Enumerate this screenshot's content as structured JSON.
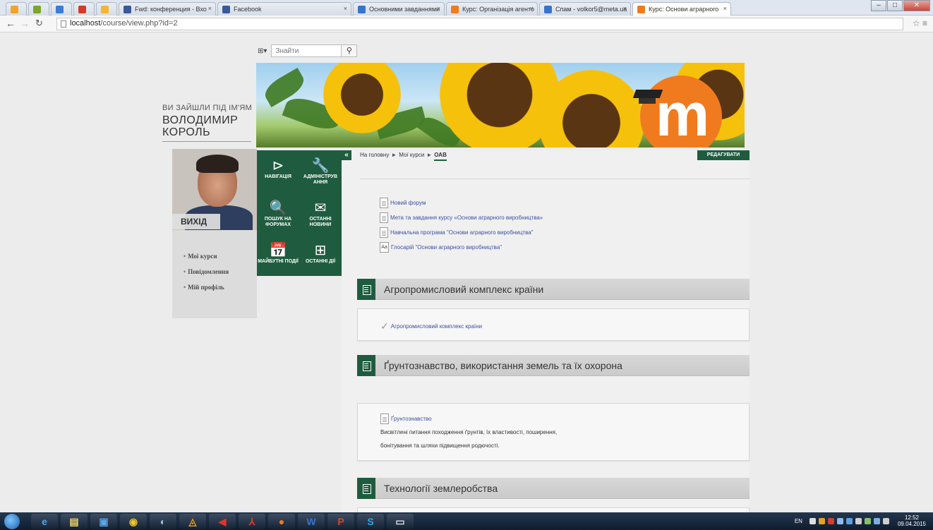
{
  "browser": {
    "tabs": [
      {
        "label": "",
        "color": "#f0a52a"
      },
      {
        "label": "",
        "color": "#7ba62b"
      },
      {
        "label": "",
        "color": "#3c7bd4"
      },
      {
        "label": "",
        "color": "#d23a2a"
      },
      {
        "label": "",
        "color": "#f3b634"
      },
      {
        "label": "Fwd: конференция - Вхо",
        "color": "#3b5998"
      },
      {
        "label": "Facebook",
        "color": "#3b5998"
      },
      {
        "label": "Основними завданнями",
        "color": "#3a73c9"
      },
      {
        "label": "Курс: Організація агенто",
        "color": "#f07b1e"
      },
      {
        "label": "Спам - volkor5@meta.ua",
        "color": "#3a73c9"
      },
      {
        "label": "Курс: Основи аграрного",
        "color": "#f07b1e"
      }
    ],
    "url_host": "localhost",
    "url_path": "/course/view.php?id=2"
  },
  "search": {
    "menu_icon": "sitemap-icon",
    "placeholder": "Знайти"
  },
  "user": {
    "greeting": "ВИ ЗАЙШЛИ ПІД ІМ'ЯМ",
    "name_line1": "ВОЛОДИМИР",
    "name_line2": "КОРОЛЬ",
    "logout": "ВИХІД",
    "links": [
      "Мої курси",
      "Повідомлення",
      "Мій профіль"
    ]
  },
  "tiles": [
    {
      "icon": "⊳",
      "label": "НАВІГАЦІЯ"
    },
    {
      "icon": "🔧",
      "label": "АДМІНІСТРУВ АННЯ"
    },
    {
      "icon": "🔍",
      "label": "ПОШУК НА ФОРУМАХ"
    },
    {
      "icon": "✉",
      "label": "ОСТАННІ НОВИНИ"
    },
    {
      "icon": "📅",
      "label": "МАЙБУТНІ ПОДІЇ"
    },
    {
      "icon": "⊞",
      "label": "ОСТАННІ ДІЇ"
    }
  ],
  "breadcrumb": {
    "home": "На головну",
    "courses": "Мої курси",
    "current": "ОАВ"
  },
  "edit_button": "РЕДАГУВАТИ",
  "top_activities": [
    "Новий форум",
    "Мета та завдання курсу «Основи аграрного виробництва»",
    "Навчальна програма \"Основи аграрного виробництва\"",
    "Глосарій \"Основи аграрного виробництва\""
  ],
  "sections": [
    {
      "title": "Агропромисловий комплекс країни",
      "activity": "Агропромисловий комплекс країни"
    },
    {
      "title": "Ґрунтознавство, використання земель та їх охорона",
      "activity": "Ґрунтознавство",
      "summary_line1": "Висвітлені питання походження ґрунтів, їх властивості, поширення,",
      "summary_line2": "бонітування та шляхи підвищення родючості."
    },
    {
      "title": "Технології землеробства"
    }
  ],
  "taskbar": {
    "lang": "EN",
    "time": "12:52",
    "date": "09.04.2015"
  },
  "colors": {
    "accent_green": "#1f5c3f",
    "moodle_orange": "#f07b1e",
    "link_blue": "#3c4fa0"
  }
}
